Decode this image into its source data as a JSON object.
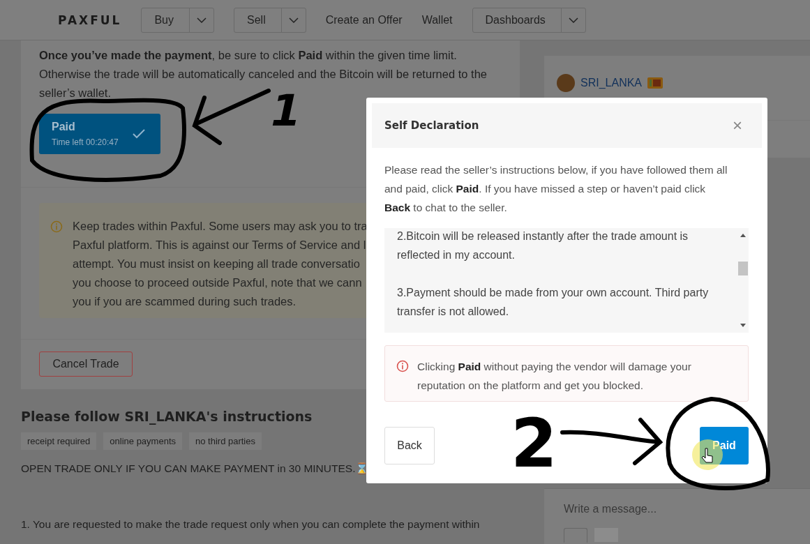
{
  "nav": {
    "logo": "PAXFUL",
    "items": [
      {
        "kind": "dropdown",
        "label": "Buy"
      },
      {
        "kind": "dropdown",
        "label": "Sell"
      },
      {
        "kind": "link",
        "label": "Create an Offer"
      },
      {
        "kind": "link",
        "label": "Wallet"
      },
      {
        "kind": "dropdown",
        "label": "Dashboards"
      }
    ]
  },
  "payment_card": {
    "instruction": "**Once you’ve made the payment**, be sure to click **Paid** within the given time limit. Otherwise the trade will be automatically canceled and the Bitcoin will be returned to the seller’s wallet.",
    "paid_button": {
      "label": "Paid",
      "timer": "Time left 00:20:47",
      "checked": true
    },
    "notice_lines": [
      "Keep trades within Paxful. Some users may ask you to tra",
      "Paxful platform. This is against our Terms of Service and l",
      "attempt. You must insist on keeping all trade conversatio",
      "you choose to proceed outside Paxful, note that we cann",
      "you if you are scammed during such trades."
    ],
    "cancel_button": "Cancel Trade"
  },
  "instructions_section": {
    "title": "Please follow SRI_LANKA's instructions",
    "tags": [
      "receipt required",
      "online payments",
      "no third parties"
    ],
    "lines": [
      "OPEN TRADE ONLY IF YOU CAN MAKE PAYMENT in 30 MINUTES.⌛",
      "1. You are requested to make the trade request only when you can complete the payment within"
    ]
  },
  "chat": {
    "username": "SRI_LANKA",
    "message_placeholder": "Write a message..."
  },
  "modal": {
    "title": "Self Declaration",
    "close": "×",
    "intro": "Please read the seller’s instructions below, if you have followed them all and paid, click **Paid**. If you have missed a step or haven’t paid click **Back** to chat to the seller.",
    "instructions": [
      "2.Bitcoin will be released instantly after the trade amount is reflected in my account.",
      "3.Payment should be made from your own account. Third party transfer is not allowed."
    ],
    "warning": "Clicking **Paid** without paying the vendor will damage your reputation on the platform and get you blocked.",
    "buttons": [
      {
        "kind": "secondary",
        "label": "Back"
      },
      {
        "kind": "primary",
        "label": "Paid"
      }
    ]
  },
  "annotations": [
    {
      "label": "1"
    },
    {
      "label": "2"
    }
  ]
}
